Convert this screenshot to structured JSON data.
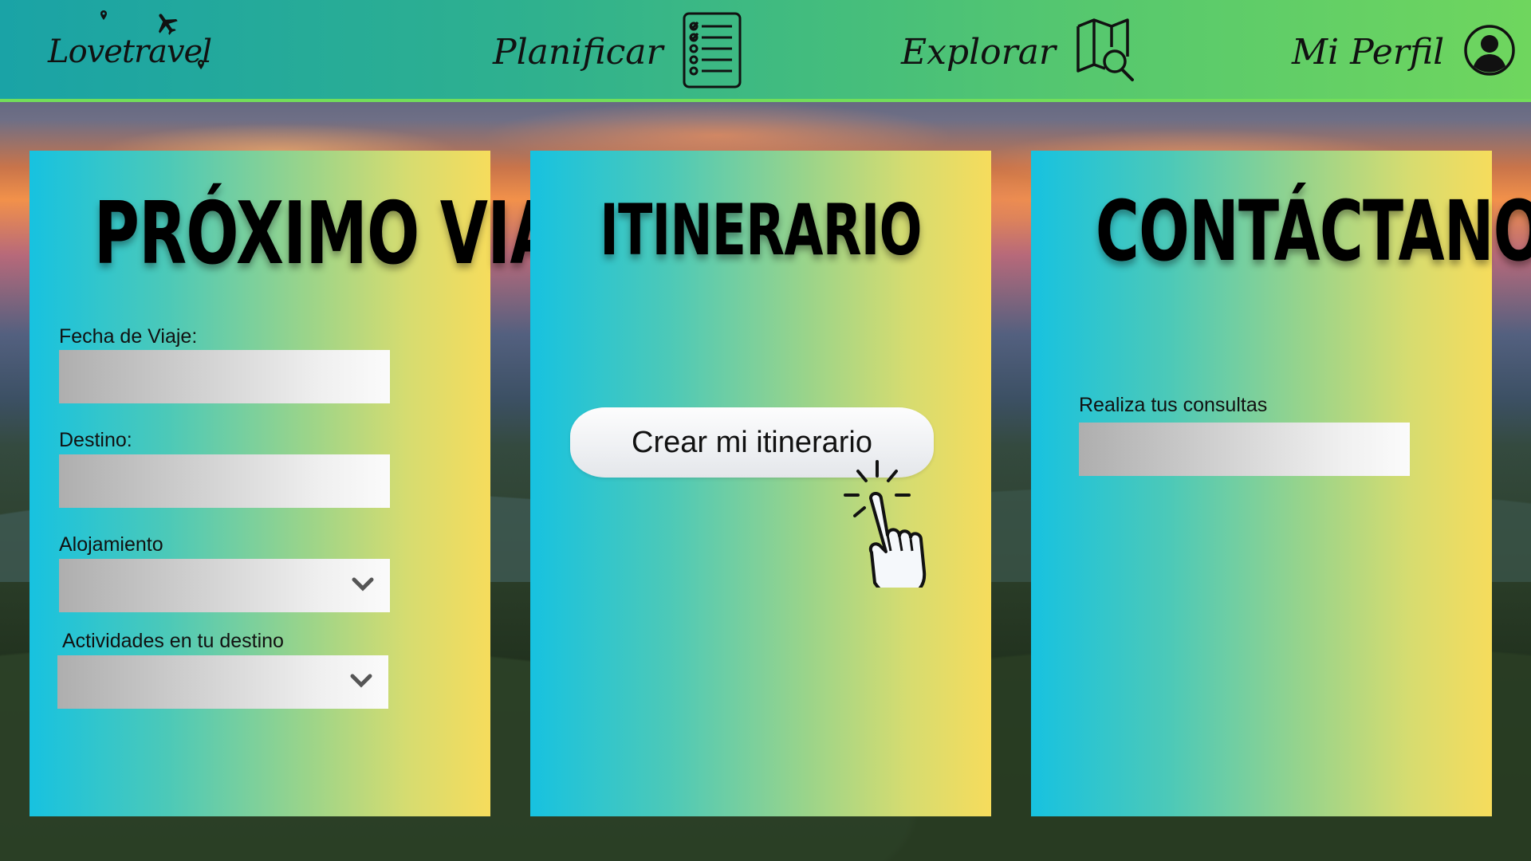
{
  "app": {
    "logo_text": "Lovetravel"
  },
  "nav": {
    "plan_label": "Planificar",
    "explore_label": "Explorar",
    "profile_label": "Mi Perfil"
  },
  "panels": {
    "next_trip": {
      "title": "PRÓXIMO VIAJE",
      "fields": {
        "date_label": "Fecha de Viaje:",
        "date_value": "",
        "destination_label": "Destino:",
        "destination_value": "",
        "lodging_label": "Alojamiento",
        "lodging_value": "",
        "activities_label": "Actividades en tu destino",
        "activities_value": ""
      }
    },
    "itinerary": {
      "title": "ITINERARIO",
      "create_button": "Crear mi itinerario"
    },
    "contact": {
      "title": "CONTÁCTANOS",
      "query_label": "Realiza tus consultas",
      "query_value": ""
    }
  },
  "colors": {
    "header_start": "#1aa3a6",
    "header_end": "#6fd65e",
    "panel_start": "#17c2e0",
    "panel_end": "#f6dc5c"
  },
  "icons": {
    "plan": "checklist-icon",
    "explore": "map-search-icon",
    "profile": "user-circle-icon",
    "pointer": "hand-pointer-icon"
  }
}
